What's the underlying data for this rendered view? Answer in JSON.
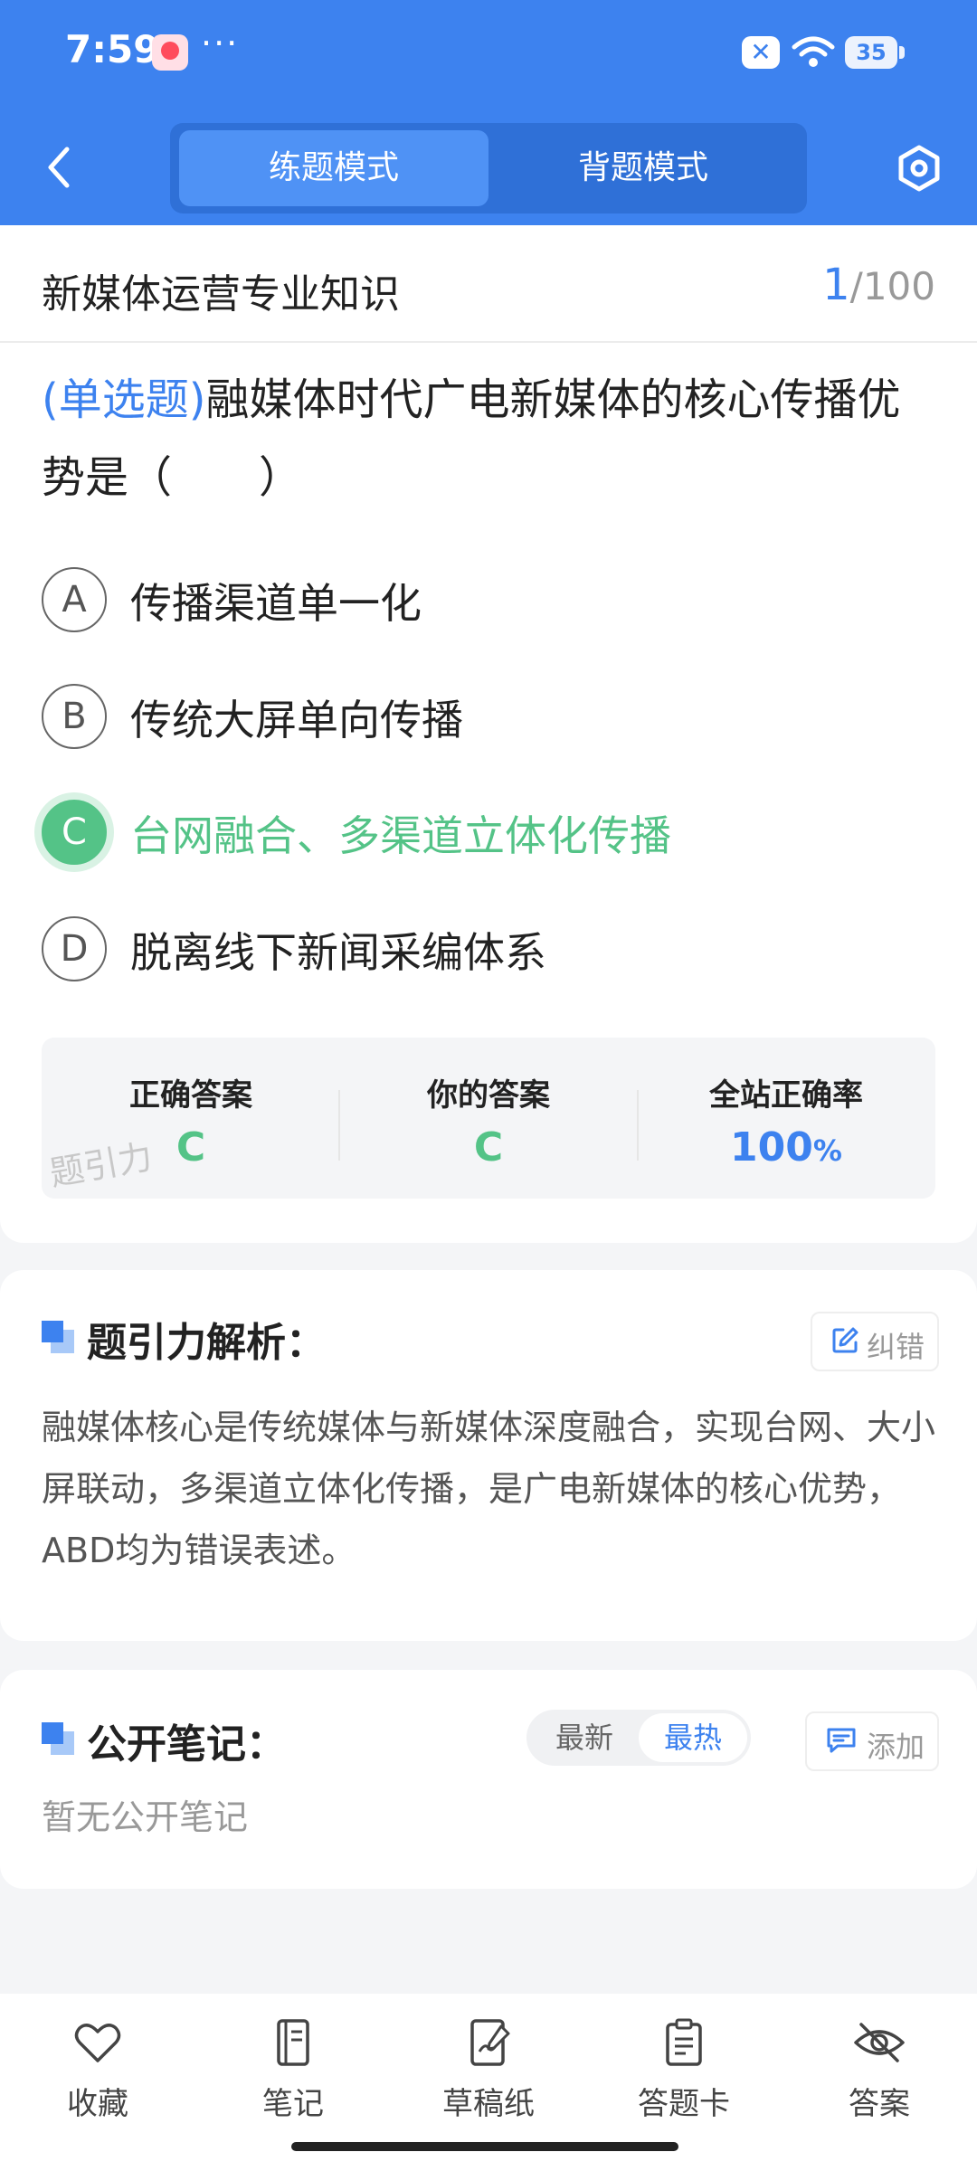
{
  "status_bar": {
    "time": "7:59",
    "more": "···",
    "battery": "35"
  },
  "header": {
    "modes": [
      "练题模式",
      "背题模式"
    ],
    "active_mode": "练题模式"
  },
  "subject": {
    "title": "新媒体运营专业知识",
    "current": "1",
    "total": "/100"
  },
  "question": {
    "type": "(单选题)",
    "text": "融媒体时代广电新媒体的核心传播优势是（　　）",
    "options": [
      {
        "letter": "A",
        "text": "传播渠道单一化"
      },
      {
        "letter": "B",
        "text": "传统大屏单向传播"
      },
      {
        "letter": "C",
        "text": "台网融合、多渠道立体化传播"
      },
      {
        "letter": "D",
        "text": "脱离线下新闻采编体系"
      }
    ]
  },
  "stats": {
    "correct_label": "正确答案",
    "correct_value": "C",
    "yours_label": "你的答案",
    "yours_value": "C",
    "rate_label": "全站正确率",
    "rate_value": "100",
    "rate_unit": "%",
    "watermark": "题引力"
  },
  "analysis": {
    "title": "题引力解析：",
    "correct_button": "纠错",
    "text": "融媒体核心是传统媒体与新媒体深度融合，实现台网、大小屏联动，多渠道立体化传播，是广电新媒体的核心优势，ABD均为错误表述。"
  },
  "notes": {
    "title": "公开笔记：",
    "sort_latest": "最新",
    "sort_hottest": "最热",
    "add_button": "添加",
    "empty": "暂无公开笔记"
  },
  "bottom_nav": [
    "收藏",
    "笔记",
    "草稿纸",
    "答题卡",
    "答案"
  ],
  "colors": {
    "primary": "#3d82ef",
    "correct": "#54c387"
  }
}
